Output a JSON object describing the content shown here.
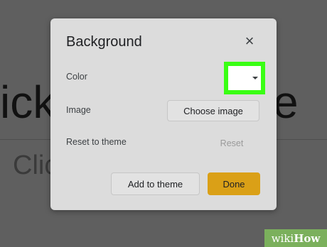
{
  "slide": {
    "title_left": "ick",
    "title_right": "e",
    "subtitle": "Clic"
  },
  "dialog": {
    "title": "Background",
    "close_icon": "close-icon",
    "close_glyph": "×",
    "color_label": "Color",
    "color_value": "#ffffff",
    "color_highlight": "#39ff14",
    "image_label": "Image",
    "choose_image_label": "Choose image",
    "reset_theme_label": "Reset to theme",
    "reset_label": "Reset",
    "add_to_theme_label": "Add to theme",
    "done_label": "Done",
    "done_color": "#daa017"
  },
  "watermark": {
    "wiki": "wiki",
    "how": "How"
  }
}
